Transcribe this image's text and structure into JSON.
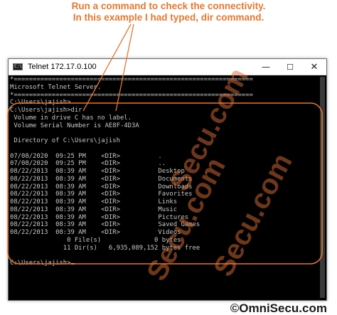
{
  "annotation": {
    "line1": "Run a command to check the connectivity.",
    "line2": "In this example I had typed, dir command."
  },
  "window": {
    "title": "Telnet 172.17.0.100",
    "icon_label": "C:\\",
    "controls": {
      "minimize": "—",
      "maximize": "☐",
      "close": "✕"
    }
  },
  "console": {
    "lines": [
      "*===============================================================",
      "Microsoft Telnet Server.",
      "*===============================================================",
      "C:\\Users\\jajish>",
      "C:\\Users\\jajish>dir",
      " Volume in drive C has no label.",
      " Volume Serial Number is AE8F-4D3A",
      "",
      " Directory of C:\\Users\\jajish",
      "",
      "07/08/2020  09:25 PM    <DIR>          .",
      "07/08/2020  09:25 PM    <DIR>          ..",
      "08/22/2013  08:39 AM    <DIR>          Desktop",
      "08/22/2013  08:39 AM    <DIR>          Documents",
      "08/22/2013  08:39 AM    <DIR>          Downloads",
      "08/22/2013  08:39 AM    <DIR>          Favorites",
      "08/22/2013  08:39 AM    <DIR>          Links",
      "08/22/2013  08:39 AM    <DIR>          Music",
      "08/22/2013  08:39 AM    <DIR>          Pictures",
      "08/22/2013  08:39 AM    <DIR>          Saved Games",
      "08/22/2013  08:39 AM    <DIR>          Videos",
      "               0 File(s)              0 bytes",
      "              11 Dir(s)   6,935,089,152 bytes free",
      "",
      "C:\\Users\\jajish>"
    ]
  },
  "watermark": {
    "text": "Secu.com"
  },
  "logo": {
    "text": "©OmniSecu.com"
  },
  "colors": {
    "annotation": "#e8772d",
    "console_text": "#c7c7c7",
    "console_background": "#000000"
  }
}
